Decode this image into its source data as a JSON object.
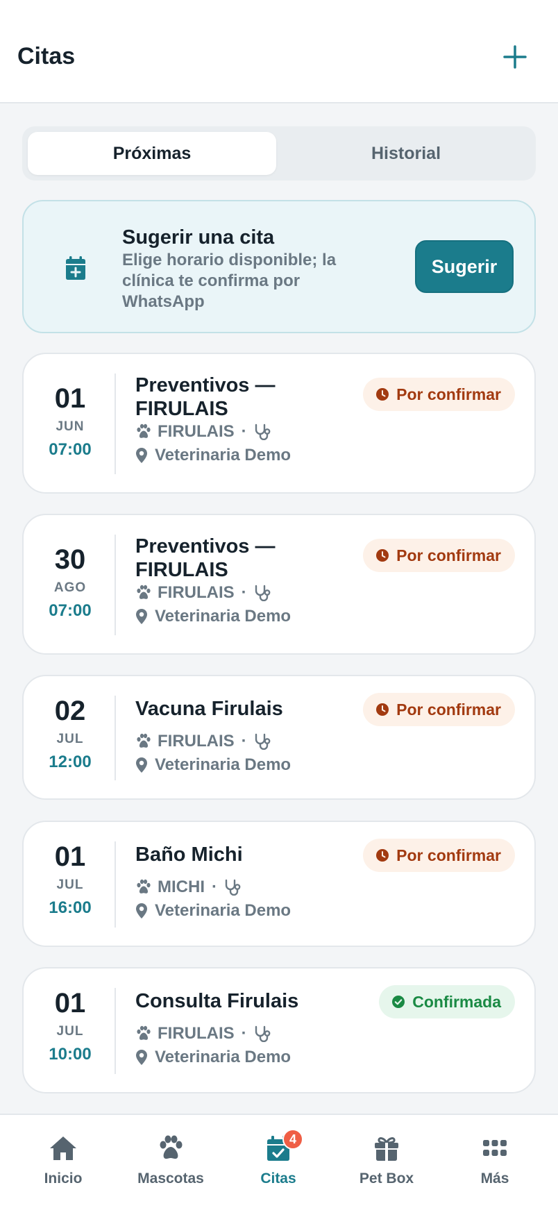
{
  "header": {
    "title": "Citas",
    "add_icon": "plus-icon"
  },
  "tabs": [
    {
      "label": "Próximas",
      "active": true
    },
    {
      "label": "Historial",
      "active": false
    }
  ],
  "suggest": {
    "icon": "calendar-plus-icon",
    "title": "Sugerir una cita",
    "description": "Elige horario disponible; la clínica te confirma por WhatsApp",
    "button": "Sugerir"
  },
  "appointments": [
    {
      "day": "01",
      "month": "JUN",
      "time": "07:00",
      "title": "Preventivos — FIRULAIS",
      "pet": "FIRULAIS",
      "clinic": "Veterinaria Demo",
      "status": "Por confirmar",
      "status_type": "pending"
    },
    {
      "day": "30",
      "month": "AGO",
      "time": "07:00",
      "title": "Preventivos — FIRULAIS",
      "pet": "FIRULAIS",
      "clinic": "Veterinaria Demo",
      "status": "Por confirmar",
      "status_type": "pending"
    },
    {
      "day": "02",
      "month": "JUL",
      "time": "12:00",
      "title": "Vacuna Firulais",
      "pet": "FIRULAIS",
      "clinic": "Veterinaria Demo",
      "status": "Por confirmar",
      "status_type": "pending"
    },
    {
      "day": "01",
      "month": "JUL",
      "time": "16:00",
      "title": "Baño Michi",
      "pet": "MICHI",
      "clinic": "Veterinaria Demo",
      "status": "Por confirmar",
      "status_type": "pending"
    },
    {
      "day": "01",
      "month": "JUL",
      "time": "10:00",
      "title": "Consulta Firulais",
      "pet": "FIRULAIS",
      "clinic": "Veterinaria Demo",
      "status": "Confirmada",
      "status_type": "confirmed"
    }
  ],
  "meta_separator": "·",
  "nav": [
    {
      "label": "Inicio",
      "icon": "home-icon",
      "active": false
    },
    {
      "label": "Mascotas",
      "icon": "paw-icon",
      "active": false
    },
    {
      "label": "Citas",
      "icon": "calendar-check-icon",
      "active": true,
      "badge": "4"
    },
    {
      "label": "Pet Box",
      "icon": "gift-icon",
      "active": false
    },
    {
      "label": "Más",
      "icon": "grid-icon",
      "active": false
    }
  ],
  "colors": {
    "accent": "#1b7c8c",
    "pending": "#a23a10",
    "confirmed": "#1a8a44",
    "badge": "#ef5e45"
  }
}
